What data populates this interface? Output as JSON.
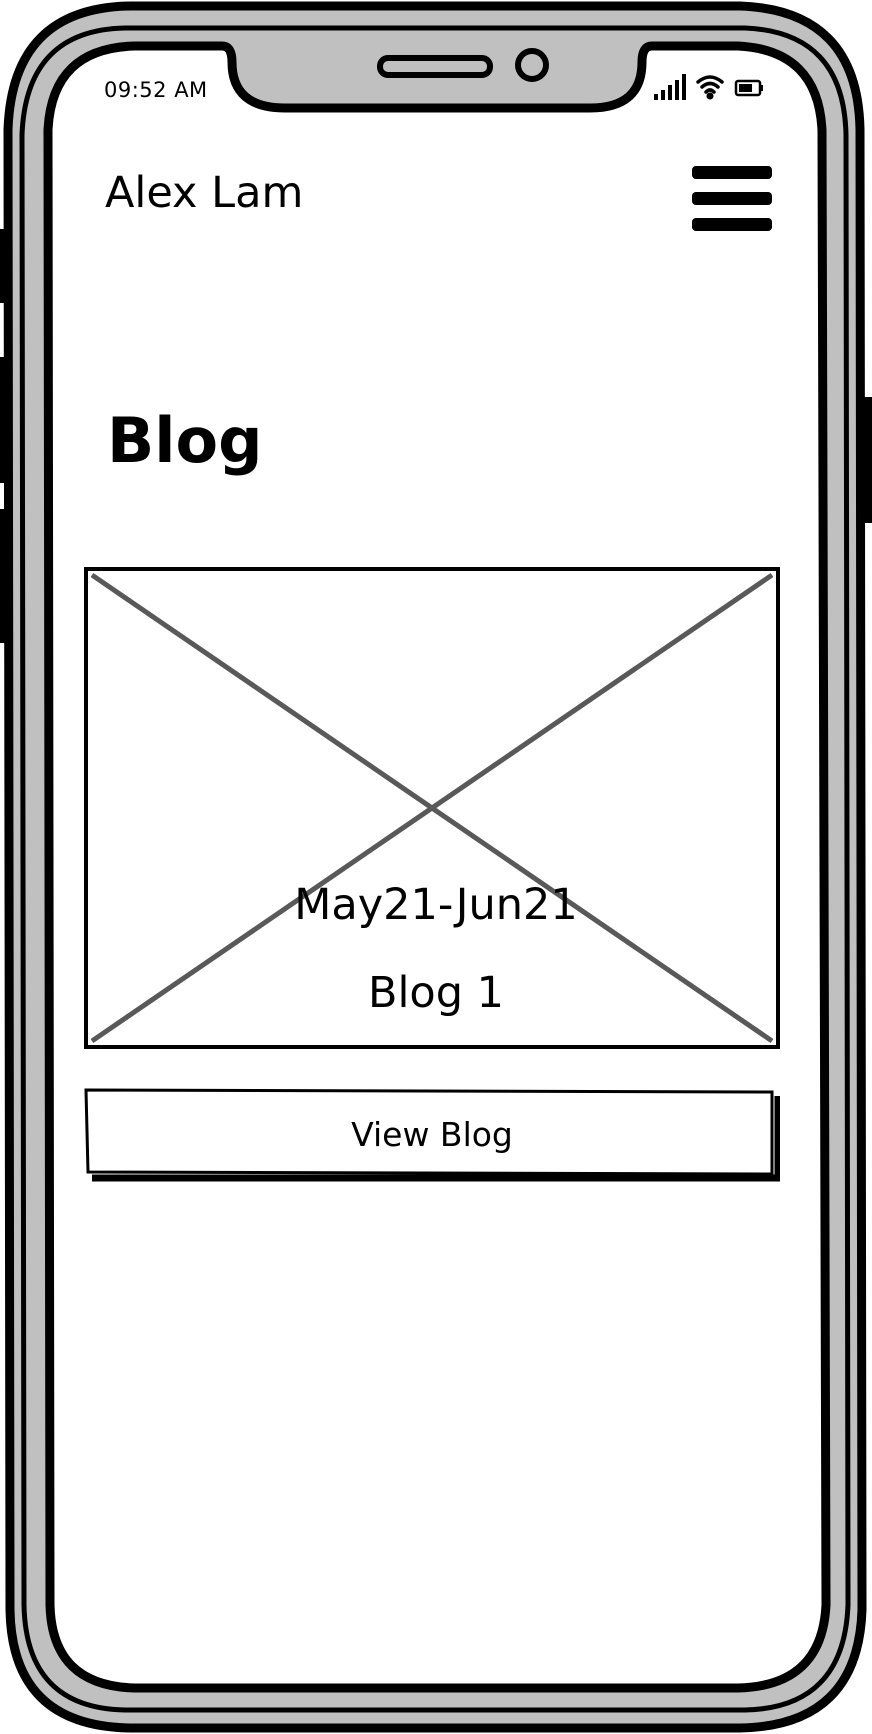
{
  "status_bar": {
    "time": "09:52 AM",
    "icons": [
      "cellular-signal-icon",
      "wifi-icon",
      "battery-icon"
    ]
  },
  "header": {
    "title": "Alex Lam",
    "menu_icon": "hamburger-menu-icon"
  },
  "page": {
    "title": "Blog"
  },
  "blog_card": {
    "image": "image-placeholder",
    "date": "May21-Jun21",
    "title": "Blog 1"
  },
  "actions": {
    "view_blog_label": "View Blog"
  },
  "colors": {
    "frame_fill": "#c0c0c0",
    "outline": "#000000",
    "placeholder_cross": "#595959",
    "screen": "#ffffff"
  }
}
